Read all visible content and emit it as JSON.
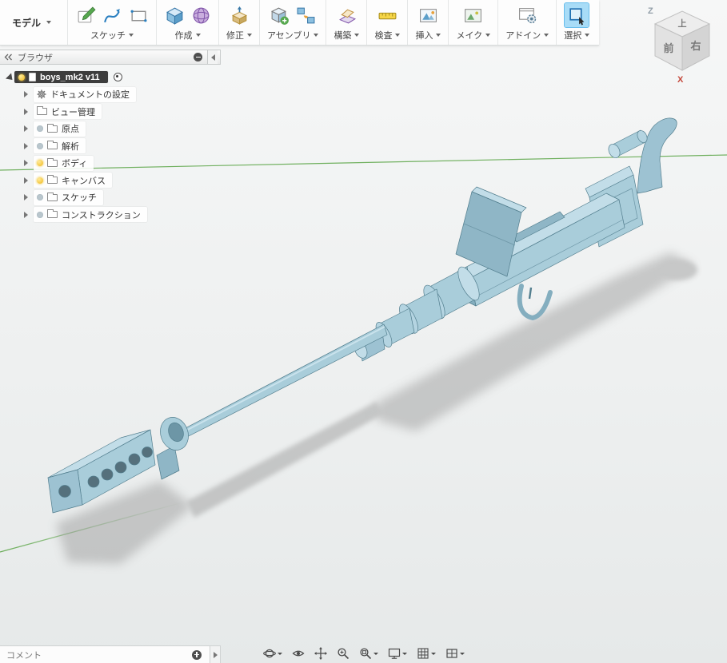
{
  "colors": {
    "selection_highlight": "#a8dcf7",
    "model_blue": "#a3c8d7",
    "ground_axis_green": "#5aa546",
    "root_row_bg": "#3d3d3d",
    "bulb_on_yellow": "#f0b81c"
  },
  "toolbar": {
    "model_menu": "モデル",
    "groups": [
      {
        "label": "スケッチ",
        "icons": [
          "create-sketch-icon",
          "spline-icon",
          "rectangle-icon"
        ],
        "active": false
      },
      {
        "label": "作成",
        "icons": [
          "extrude-icon",
          "form-icon"
        ],
        "active": false
      },
      {
        "label": "修正",
        "icons": [
          "press-pull-icon"
        ],
        "active": false
      },
      {
        "label": "アセンブリ",
        "icons": [
          "new-component-icon",
          "joint-icon"
        ],
        "active": false
      },
      {
        "label": "構築",
        "icons": [
          "construction-plane-icon"
        ],
        "active": false
      },
      {
        "label": "検査",
        "icons": [
          "measure-icon"
        ],
        "active": false
      },
      {
        "label": "挿入",
        "icons": [
          "insert-image-icon"
        ],
        "active": false
      },
      {
        "label": "メイク",
        "icons": [
          "make-icon"
        ],
        "active": false
      },
      {
        "label": "アドイン",
        "icons": [
          "addins-icon"
        ],
        "active": false
      },
      {
        "label": "選択",
        "icons": [
          "select-icon"
        ],
        "active": true
      }
    ]
  },
  "browser": {
    "title": "ブラウザ",
    "root": {
      "label": "boys_mk2 v11",
      "visibility": "on",
      "icon": "document-icon"
    },
    "items": [
      {
        "label": "ドキュメントの設定",
        "icon": "gear-icon",
        "visibility": null
      },
      {
        "label": "ビュー管理",
        "icon": "folder-icon",
        "visibility": null
      },
      {
        "label": "原点",
        "icon": "folder-icon",
        "visibility": "off"
      },
      {
        "label": "解析",
        "icon": "folder-icon",
        "visibility": "off"
      },
      {
        "label": "ボディ",
        "icon": "folder-icon",
        "visibility": "on"
      },
      {
        "label": "キャンバス",
        "icon": "folder-icon",
        "visibility": "on"
      },
      {
        "label": "スケッチ",
        "icon": "folder-icon",
        "visibility": "off"
      },
      {
        "label": "コンストラクション",
        "icon": "folder-icon",
        "visibility": "off"
      }
    ]
  },
  "viewcube": {
    "top_face": "上",
    "front_face": "前",
    "right_face": "右",
    "z_axis": "Z",
    "x_axis": "X"
  },
  "comment_bar": {
    "label": "コメント"
  },
  "nav_bar": {
    "items": [
      {
        "name": "orbit",
        "dropdown": true
      },
      {
        "name": "look-at",
        "dropdown": false
      },
      {
        "name": "pan",
        "dropdown": false
      },
      {
        "name": "zoom",
        "dropdown": false
      },
      {
        "name": "fit",
        "dropdown": true
      },
      {
        "name": "display-settings",
        "dropdown": true
      },
      {
        "name": "grid-and-snaps",
        "dropdown": true
      },
      {
        "name": "viewports",
        "dropdown": true
      }
    ]
  }
}
